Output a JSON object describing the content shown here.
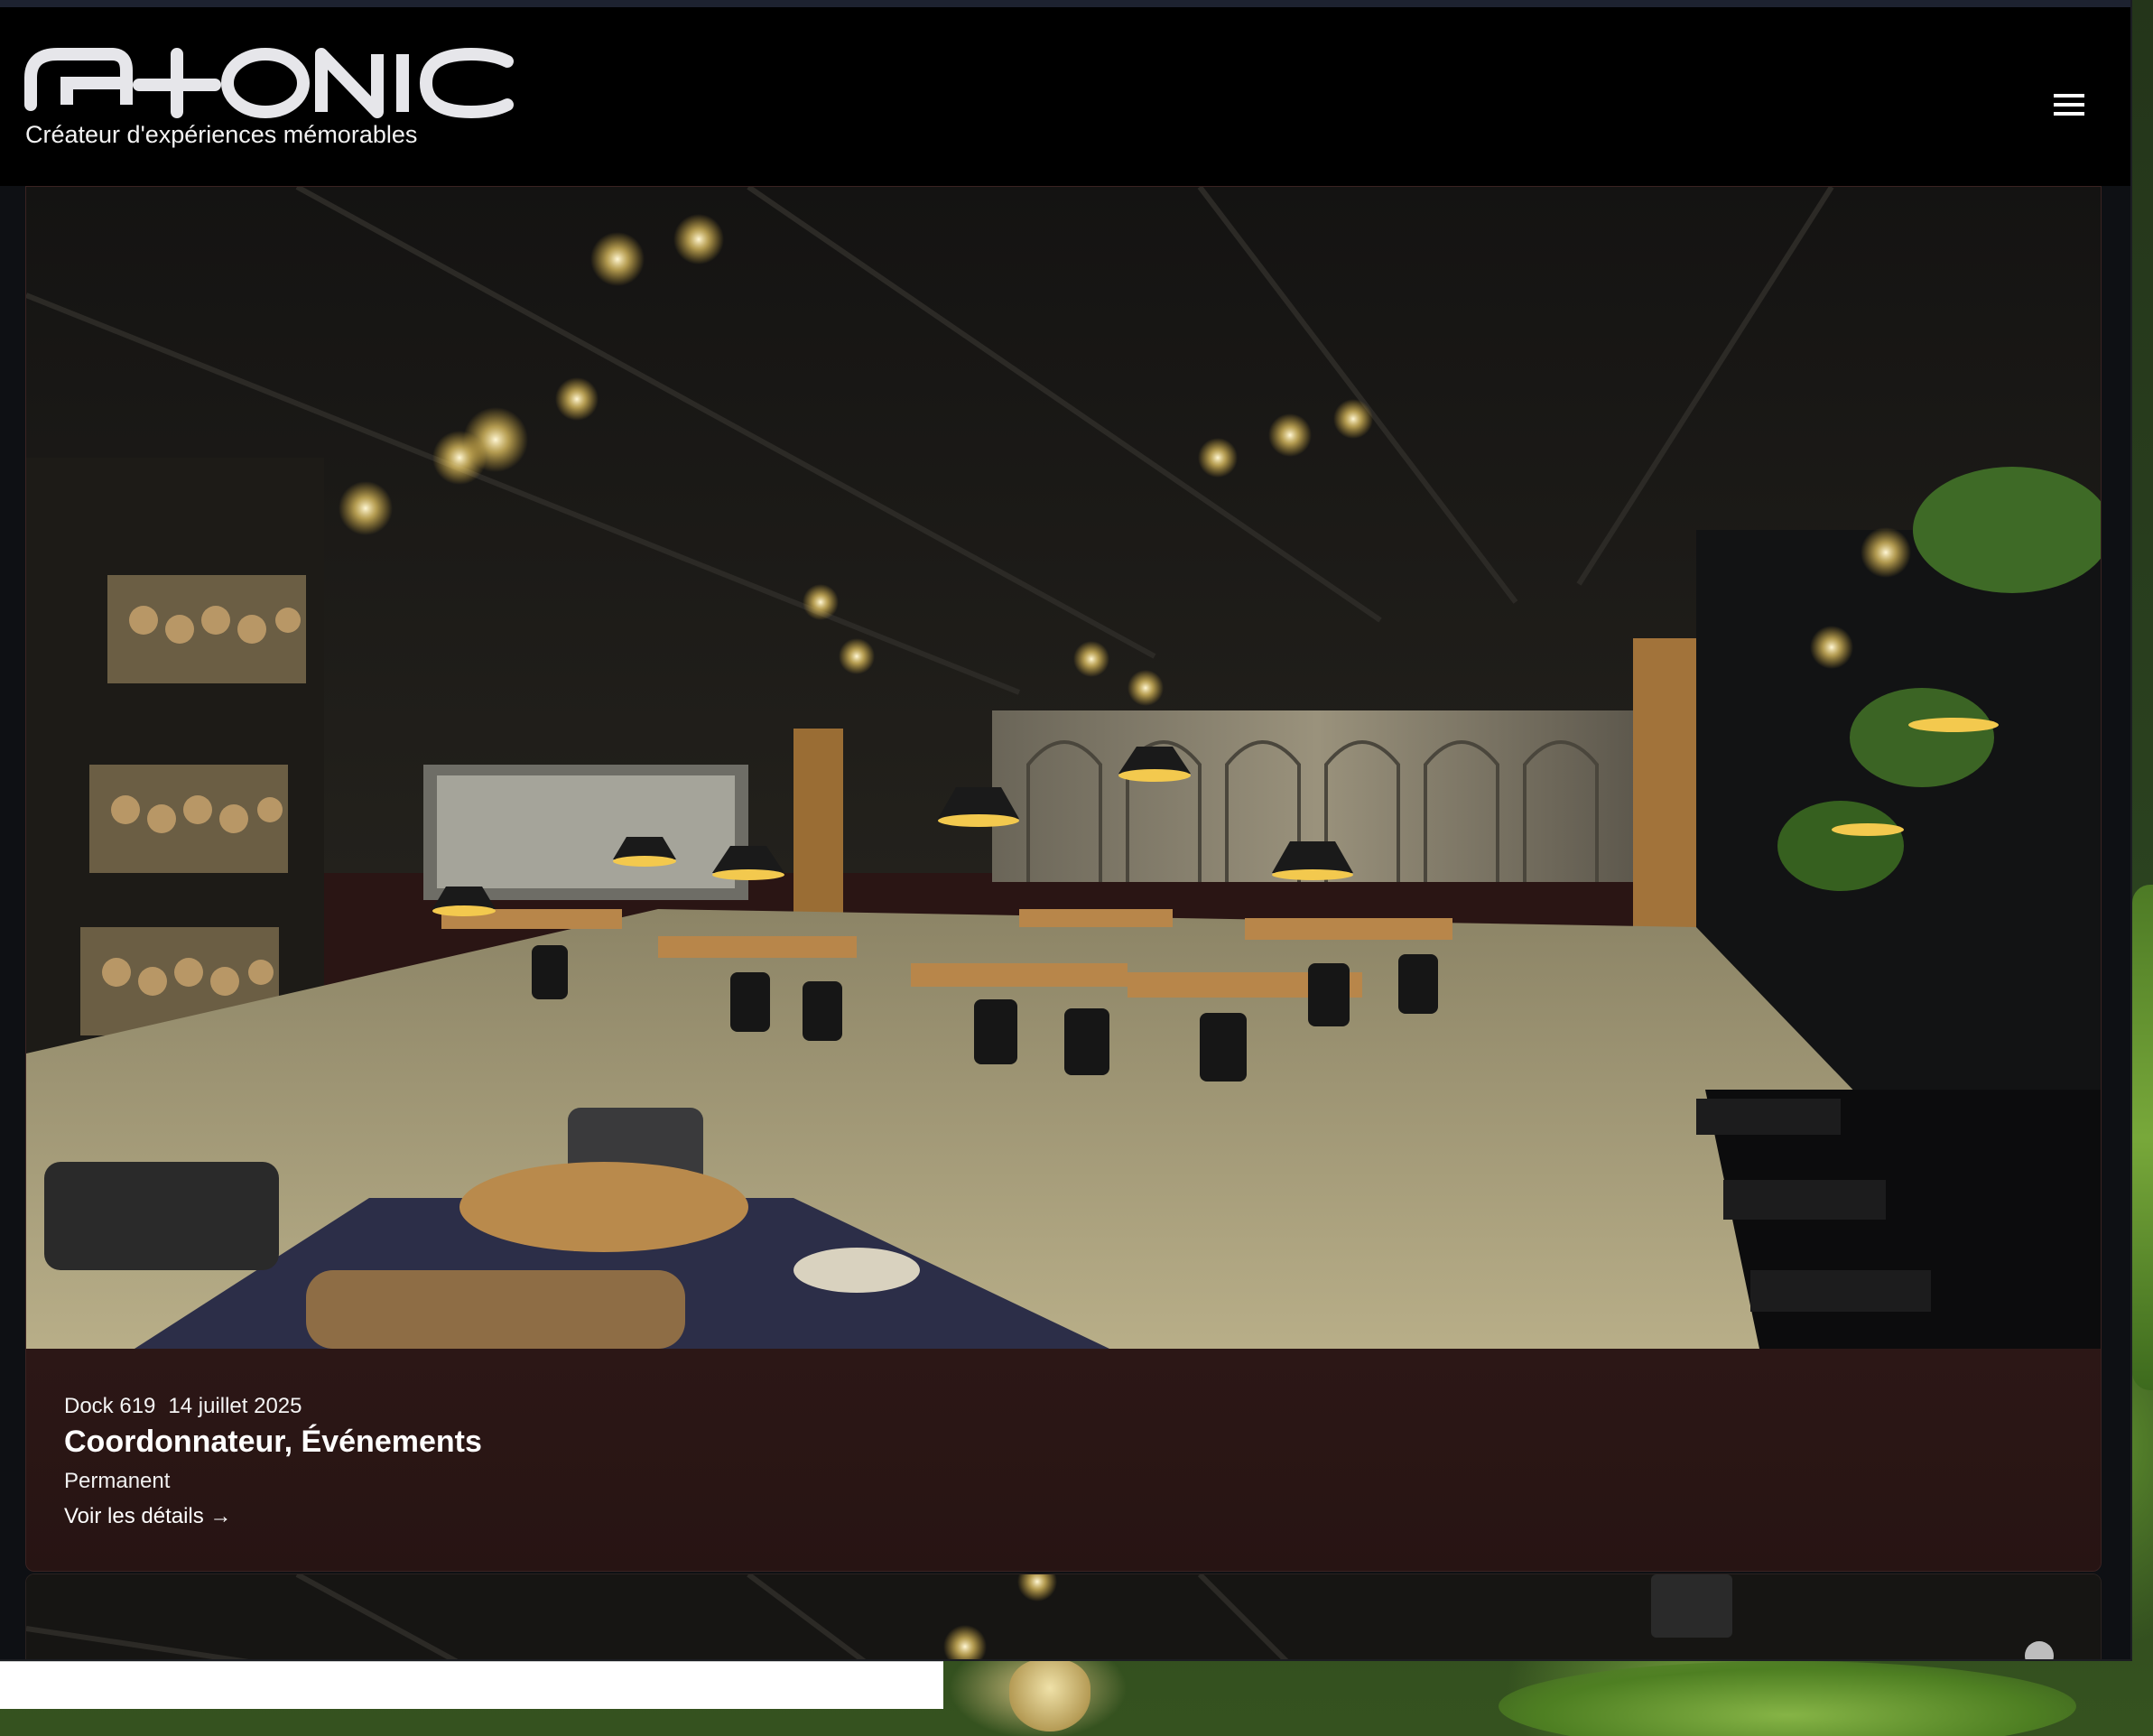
{
  "brand": {
    "logo_text": "G+ONIC",
    "tagline": "Créateur d'expériences mémorables"
  },
  "header": {
    "menu_icon": "hamburger-menu-icon"
  },
  "jobs": [
    {
      "company": "Dock 619",
      "date": "14 juillet 2025",
      "title": "Coordonnateur, Événements",
      "type": "Permanent",
      "details_label": "Voir les détails →",
      "image_subject": "restaurant-interior-photo"
    }
  ],
  "colors": {
    "header_bg": "#000000",
    "card_bg": "#2a1514",
    "text": "#ffffff",
    "accent_light": "#f5c542"
  }
}
